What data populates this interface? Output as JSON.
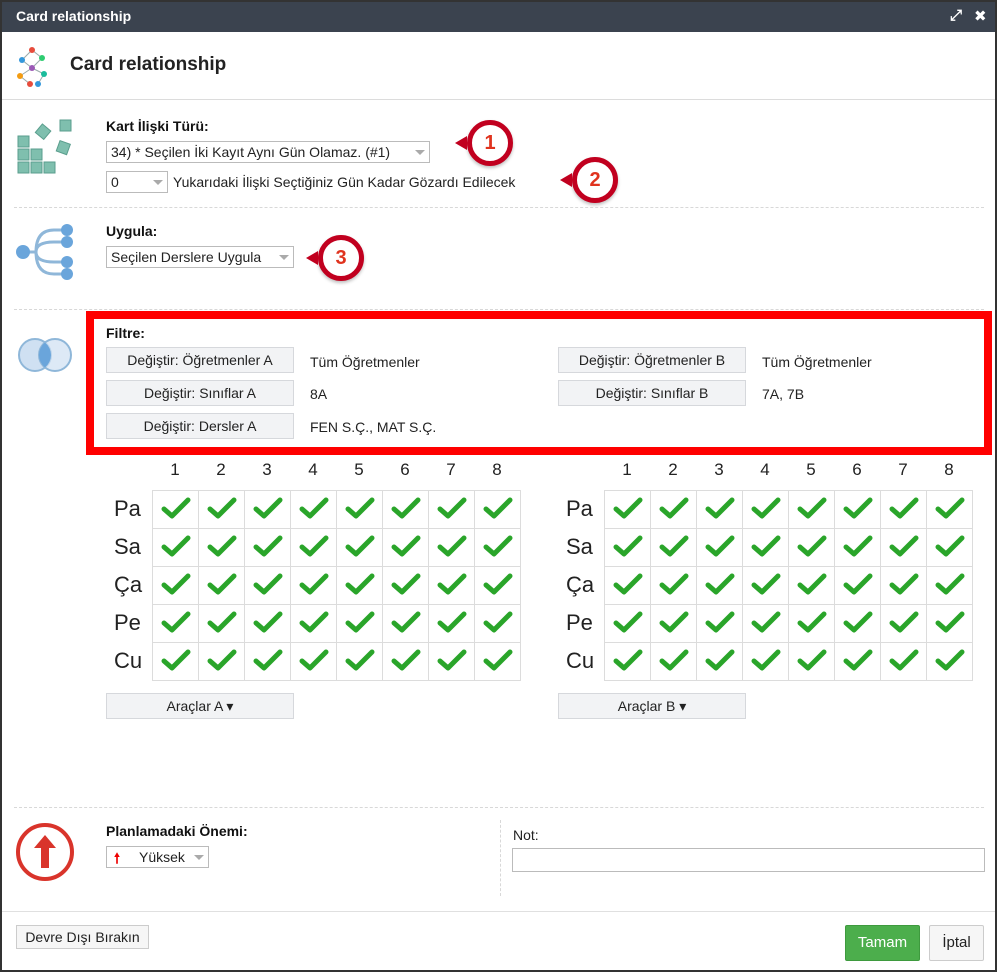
{
  "window": {
    "title": "Card relationship",
    "icons": [
      "expand-icon",
      "close-icon"
    ]
  },
  "header": {
    "title": "Card relationship"
  },
  "relation": {
    "label": "Kart İlişki Türü:",
    "type_value": "34) * Seçilen İki Kayıt Aynı Gün Olamaz. (#1)",
    "days_value": "0",
    "days_text": "Yukarıdaki İlişki Seçtiğiniz Gün Kadar Gözardı Edilecek"
  },
  "apply": {
    "label": "Uygula:",
    "value": "Seçilen Derslere Uygula"
  },
  "badges": [
    "1",
    "2",
    "3"
  ],
  "filter": {
    "label": "Filtre:",
    "teachers_a_button": "Değiştir: Öğretmenler A",
    "teachers_a_value": "Tüm Öğretmenler",
    "classes_a_button": "Değiştir: Sınıflar A",
    "classes_a_value": "8A",
    "subjects_a_button": "Değiştir: Dersler A",
    "subjects_a_value": "FEN S.Ç., MAT S.Ç.",
    "teachers_b_button": "Değiştir: Öğretmenler B",
    "teachers_b_value": "Tüm Öğretmenler",
    "classes_b_button": "Değiştir: Sınıflar B",
    "classes_b_value": "7A, 7B"
  },
  "grid": {
    "periods": [
      "1",
      "2",
      "3",
      "4",
      "5",
      "6",
      "7",
      "8"
    ],
    "days": [
      "Pa",
      "Sa",
      "Ça",
      "Pe",
      "Cu"
    ],
    "all_checked": true,
    "check_color": "#2aa52a"
  },
  "tools": {
    "a": "Araçlar A ▾",
    "b": "Araçlar B ▾"
  },
  "importance": {
    "label": "Planlamadaki Önemi:",
    "value": "Yüksek",
    "arrow_icon": "up-arrow-icon"
  },
  "note": {
    "label": "Not:",
    "value": ""
  },
  "footer": {
    "disable": "Devre Dışı Bırakın",
    "ok": "Tamam",
    "cancel": "İptal"
  },
  "colors": {
    "titlebar": "#3b434f",
    "badge_ring": "#c1001f",
    "filter_border": "#ff0000",
    "ok_green": "#4cae4c",
    "icon_teal": "#6fb3a1",
    "icon_blue": "#5b9bd5",
    "importance_red": "#d9342b"
  }
}
